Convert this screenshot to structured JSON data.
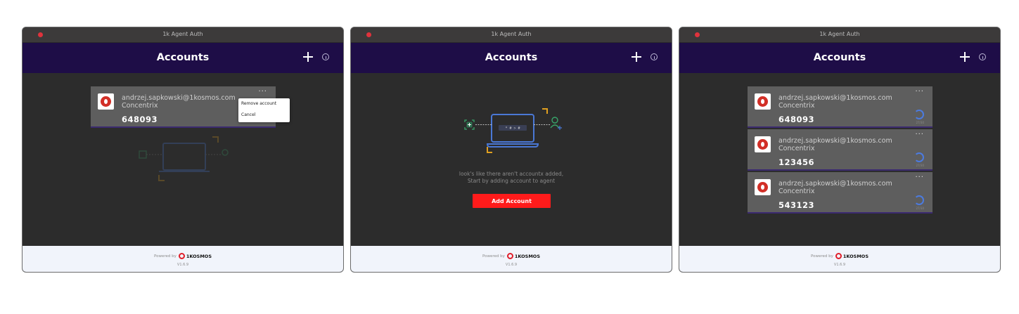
{
  "window_title": "1k Agent Auth",
  "header_title": "Accounts",
  "footer": {
    "powered_by": "Powered by",
    "brand": "1KOSMOS",
    "version": "V1.6.9"
  },
  "colors": {
    "header_bg": "#1e0d47",
    "add_button": "#ff1b1b",
    "close_dot": "#e0323c",
    "timer": "#4b7be0"
  },
  "icons": {
    "add": "plus-icon",
    "info": "info-icon",
    "more": "ellipsis-icon",
    "logo": "concentrix-logo",
    "timer": "timer-ring-icon"
  },
  "panel1": {
    "account": {
      "email": "andrzej.sapkowski@1kosmos.com",
      "org": "Concentrix",
      "code": "648093"
    },
    "menu": {
      "remove": "Remove account",
      "cancel": "Cancel"
    }
  },
  "panel2": {
    "empty_line1": "look's like there aren't accountx added,",
    "empty_line2": "Start by adding account to agent",
    "add_button": "Add Account",
    "laptop_code": "* # > #"
  },
  "panel3": {
    "accounts": [
      {
        "email": "andrzej.sapkowski@1kosmos.com",
        "org": "Concentrix",
        "code": "648093",
        "timer_label": "27/30"
      },
      {
        "email": "andrzej.sapkowski@1kosmos.com",
        "org": "Concentrix",
        "code": "123456",
        "timer_label": "27/30"
      },
      {
        "email": "andrzej.sapkowski@1kosmos.com",
        "org": "Concentrix",
        "code": "543123",
        "timer_label": "27/30"
      }
    ]
  }
}
